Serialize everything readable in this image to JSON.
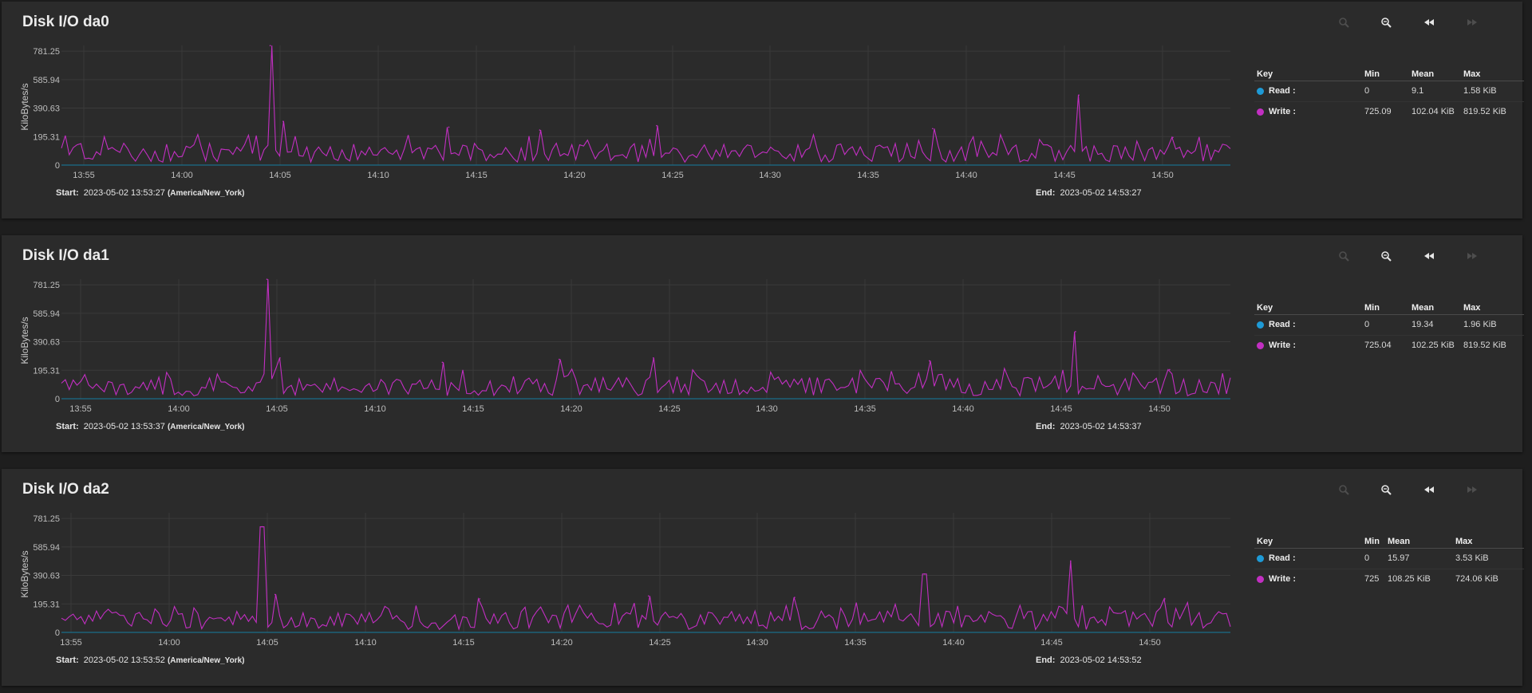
{
  "colors": {
    "read": "#1e9ad6",
    "write": "#c22fc2",
    "grid": "#3a3a3a",
    "baseline": "#1a6d8a"
  },
  "toolbar_icons": [
    "search-icon",
    "zoom-in-icon",
    "rewind-icon",
    "forward-icon"
  ],
  "y_axis_label": "KiloBytes/s",
  "panels": [
    {
      "title": "Disk I/O da0",
      "start_label": "Start:",
      "start_value": "2023-05-02 13:53:27",
      "start_tz": "(America/New_York)",
      "end_label": "End:",
      "end_value": "2023-05-02 14:53:27",
      "legend_head": {
        "key": "Key",
        "min": "Min",
        "mean": "Mean",
        "max": "Max"
      },
      "legend": [
        {
          "name": "Read :",
          "min": "0",
          "mean": "9.1",
          "max": "1.58 KiB"
        },
        {
          "name": "Write :",
          "min": "725.09",
          "mean": "102.04 KiB",
          "max": "819.52 KiB"
        }
      ]
    },
    {
      "title": "Disk I/O da1",
      "start_label": "Start:",
      "start_value": "2023-05-02 13:53:37",
      "start_tz": "(America/New_York)",
      "end_label": "End:",
      "end_value": "2023-05-02 14:53:37",
      "legend_head": {
        "key": "Key",
        "min": "Min",
        "mean": "Mean",
        "max": "Max"
      },
      "legend": [
        {
          "name": "Read :",
          "min": "0",
          "mean": "19.34",
          "max": "1.96 KiB"
        },
        {
          "name": "Write :",
          "min": "725.04",
          "mean": "102.25 KiB",
          "max": "819.52 KiB"
        }
      ]
    },
    {
      "title": "Disk I/O da2",
      "start_label": "Start:",
      "start_value": "2023-05-02 13:53:52",
      "start_tz": "(America/New_York)",
      "end_label": "End:",
      "end_value": "2023-05-02 14:53:52",
      "legend_head": {
        "key": "Key",
        "min": "Min",
        "mean": "Mean",
        "max": "Max"
      },
      "legend": [
        {
          "name": "Read :",
          "min": "0",
          "mean": "15.97",
          "max": "3.53 KiB"
        },
        {
          "name": "Write :",
          "min": "725",
          "mean": "108.25 KiB",
          "max": "724.06 KiB"
        }
      ]
    }
  ],
  "chart_data": [
    {
      "type": "line",
      "title": "Disk I/O da0",
      "ylabel": "KiloBytes/s",
      "ylim": [
        0,
        820
      ],
      "yticks": [
        "0",
        "195.31",
        "390.63",
        "585.94",
        "781.25"
      ],
      "ytick_values": [
        0,
        195.31,
        390.63,
        585.94,
        781.25
      ],
      "x_start": "13:53:27",
      "x_end": "14:53:27",
      "xticks": [
        "13:55",
        "14:00",
        "14:05",
        "14:10",
        "14:15",
        "14:20",
        "14:25",
        "14:30",
        "14:35",
        "14:40",
        "14:45",
        "14:50"
      ],
      "grid": true,
      "series": [
        {
          "name": "Read",
          "constant": 0
        },
        {
          "name": "Write",
          "peaks": [
            {
              "x": "14:04:10",
              "value": 819
            },
            {
              "x": "14:04:50",
              "value": 300
            },
            {
              "x": "14:13:20",
              "value": 260
            },
            {
              "x": "14:18:00",
              "value": 240
            },
            {
              "x": "14:24:00",
              "value": 270
            },
            {
              "x": "14:38:10",
              "value": 250
            },
            {
              "x": "14:45:40",
              "value": 480
            },
            {
              "x": "14:50:30",
              "value": 190
            }
          ],
          "baseline_range": [
            20,
            150
          ]
        }
      ]
    },
    {
      "type": "line",
      "title": "Disk I/O da1",
      "ylabel": "KiloBytes/s",
      "ylim": [
        0,
        820
      ],
      "yticks": [
        "0",
        "195.31",
        "390.63",
        "585.94",
        "781.25"
      ],
      "ytick_values": [
        0,
        195.31,
        390.63,
        585.94,
        781.25
      ],
      "x_start": "13:53:37",
      "x_end": "14:53:37",
      "xticks": [
        "13:55",
        "14:00",
        "14:05",
        "14:10",
        "14:15",
        "14:20",
        "14:25",
        "14:30",
        "14:35",
        "14:40",
        "14:45",
        "14:50"
      ],
      "grid": true,
      "series": [
        {
          "name": "Read",
          "constant": 0
        },
        {
          "name": "Write",
          "peaks": [
            {
              "x": "14:04:10",
              "value": 819
            },
            {
              "x": "14:04:50",
              "value": 280
            },
            {
              "x": "14:13:10",
              "value": 250
            },
            {
              "x": "14:19:10",
              "value": 270
            },
            {
              "x": "14:24:00",
              "value": 280
            },
            {
              "x": "14:38:10",
              "value": 260
            },
            {
              "x": "14:45:40",
              "value": 460
            },
            {
              "x": "14:50:30",
              "value": 200
            }
          ],
          "baseline_range": [
            20,
            150
          ]
        }
      ]
    },
    {
      "type": "line",
      "title": "Disk I/O da2",
      "ylabel": "KiloBytes/s",
      "ylim": [
        0,
        820
      ],
      "yticks": [
        "0",
        "195.31",
        "390.63",
        "585.94",
        "781.25"
      ],
      "ytick_values": [
        0,
        195.31,
        390.63,
        585.94,
        781.25
      ],
      "x_start": "13:53:52",
      "x_end": "14:53:52",
      "xticks": [
        "13:55",
        "14:00",
        "14:05",
        "14:10",
        "14:15",
        "14:20",
        "14:25",
        "14:30",
        "14:35",
        "14:40",
        "14:45",
        "14:50"
      ],
      "grid": true,
      "series": [
        {
          "name": "Read",
          "constant": 0
        },
        {
          "name": "Write",
          "peaks": [
            {
              "x": "14:04:10",
              "value": 724
            },
            {
              "x": "14:04:50",
              "value": 260
            },
            {
              "x": "14:15:20",
              "value": 230
            },
            {
              "x": "14:24:00",
              "value": 250
            },
            {
              "x": "14:31:30",
              "value": 240
            },
            {
              "x": "14:38:10",
              "value": 400
            },
            {
              "x": "14:45:40",
              "value": 490
            },
            {
              "x": "14:50:30",
              "value": 230
            }
          ],
          "baseline_range": [
            20,
            150
          ]
        }
      ]
    }
  ]
}
